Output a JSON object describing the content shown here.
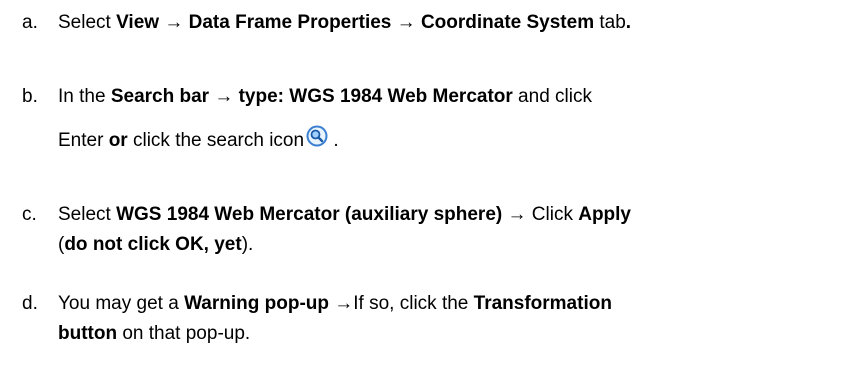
{
  "steps": [
    {
      "letter": "a.",
      "parts": [
        "Select ",
        "View",
        " → ",
        "Data Frame Properties",
        " → ",
        "Coordinate System",
        " tab",
        "."
      ]
    },
    {
      "letter": "b.",
      "parts": [
        "In the ",
        "Search bar → type: WGS 1984 Web Mercator",
        " and click"
      ],
      "line2_parts": [
        "Enter ",
        "or",
        " click the search icon",
        " ."
      ]
    },
    {
      "letter": "c.",
      "parts": [
        "Select ",
        "WGS 1984 Web Mercator (auxiliary sphere)",
        " → Click ",
        "Apply"
      ],
      "line2_parts": [
        "(",
        "do not click OK, yet",
        ")."
      ]
    },
    {
      "letter": "d.",
      "parts": [
        "You may get a ",
        "Warning pop-up",
        " →If so, click the ",
        "Transformation"
      ],
      "line2_parts": [
        "button",
        " on that pop-up."
      ]
    }
  ],
  "icons": {
    "search": "magnifier-icon"
  },
  "colors": {
    "icon_blue": "#3a7fd0",
    "icon_light": "#9fd0ff"
  }
}
